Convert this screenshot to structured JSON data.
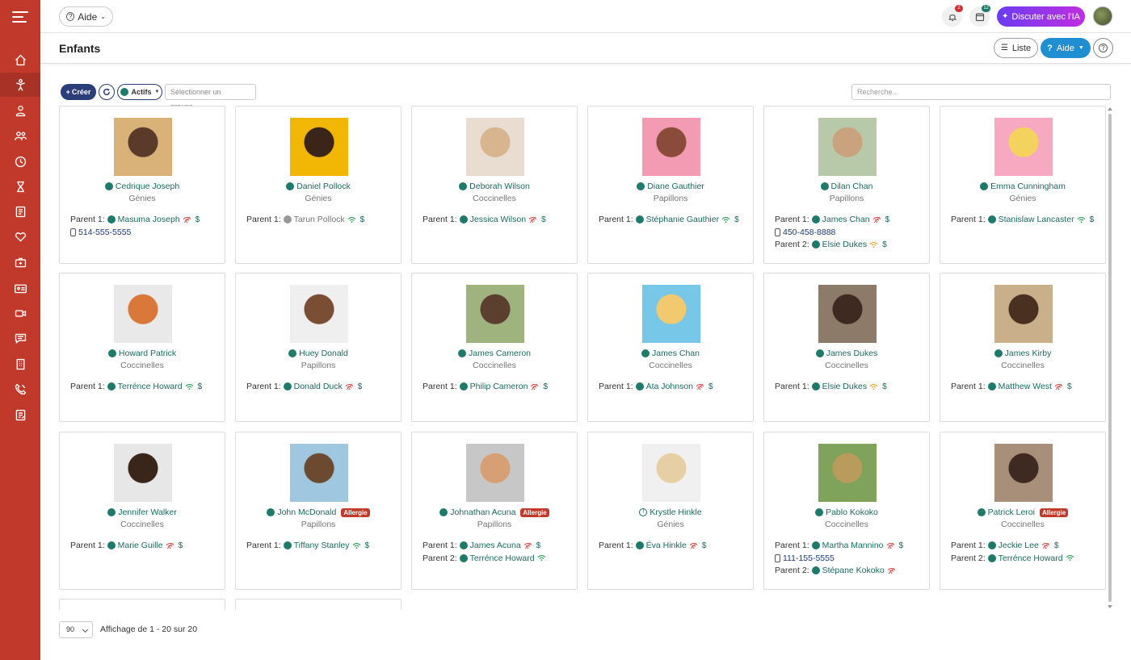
{
  "topbar": {
    "aide_label": "Aide",
    "notifications_count": "2",
    "calendar_count": "12",
    "ai_label": "Discuter avec l'IA"
  },
  "header": {
    "title": "Enfants",
    "liste_label": "Liste",
    "aide_label": "Aide"
  },
  "toolbar": {
    "create_label": "Créer",
    "status_label": "Actifs",
    "group_placeholder": "Sélectionner un groupe...",
    "search_placeholder": "Recherche..."
  },
  "colors": {
    "sidebar": "#c0392b",
    "accent_navy": "#2c3e7a",
    "active_dot": "#1e7a6a",
    "link": "#1a6b60",
    "allergy_badge": "#c0392b",
    "ai_gradient_start": "#6a3df0",
    "ai_gradient_end": "#c02ee0",
    "help_blue": "#1f8fd1"
  },
  "labels": {
    "parent1": "Parent 1:",
    "parent2": "Parent 2:",
    "dollar": "$",
    "allergy": "Allergie"
  },
  "children": [
    {
      "name": "Cedrique Joseph",
      "group": "Génies",
      "parents": [
        {
          "label": "Parent 1:",
          "name": "Masuma Joseph",
          "wifi": "red",
          "dollar": true
        }
      ],
      "phone": "514-555-5555"
    },
    {
      "name": "Daniel Pollock",
      "group": "Génies",
      "parents": [
        {
          "label": "Parent 1:",
          "name": "Tarun Pollock",
          "wifi": "green",
          "dollar": true,
          "inactive": true
        }
      ]
    },
    {
      "name": "Deborah Wilson",
      "group": "Coccinelles",
      "parents": [
        {
          "label": "Parent 1:",
          "name": "Jessica Wilson",
          "wifi": "red",
          "dollar": true
        }
      ]
    },
    {
      "name": "Diane Gauthier",
      "group": "Papillons",
      "parents": [
        {
          "label": "Parent 1:",
          "name": "Stéphanie Gauthier",
          "wifi": "green",
          "dollar": true
        }
      ]
    },
    {
      "name": "Dilan Chan",
      "group": "Papillons",
      "parents": [
        {
          "label": "Parent 1:",
          "name": "James Chan",
          "wifi": "red",
          "dollar": true
        },
        {
          "label": "Parent 2:",
          "name": "Elsie Dukes",
          "wifi": "orange",
          "dollar": true
        }
      ],
      "phone": "450-458-8888"
    },
    {
      "name": "Emma Cunningham",
      "group": "Génies",
      "parents": [
        {
          "label": "Parent 1:",
          "name": "Stanislaw Lancaster",
          "wifi": "green",
          "dollar": true
        }
      ]
    },
    {
      "name": "Howard Patrick",
      "group": "Coccinelles",
      "parents": [
        {
          "label": "Parent 1:",
          "name": "Terrénce Howard",
          "wifi": "green",
          "dollar": true
        }
      ]
    },
    {
      "name": "Huey Donald",
      "group": "Papillons",
      "parents": [
        {
          "label": "Parent 1:",
          "name": "Donald Duck",
          "wifi": "red",
          "dollar": true
        }
      ]
    },
    {
      "name": "James Cameron",
      "group": "Coccinelles",
      "parents": [
        {
          "label": "Parent 1:",
          "name": "Philip Cameron",
          "wifi": "red",
          "dollar": true
        }
      ]
    },
    {
      "name": "James Chan",
      "group": "Coccinelles",
      "parents": [
        {
          "label": "Parent 1:",
          "name": "Ata Johnson",
          "wifi": "red",
          "dollar": true
        }
      ]
    },
    {
      "name": "James Dukes",
      "group": "Coccinelles",
      "parents": [
        {
          "label": "Parent 1:",
          "name": "Elsie Dukes",
          "wifi": "orange",
          "dollar": true
        }
      ]
    },
    {
      "name": "James Kirby",
      "group": "Coccinelles",
      "parents": [
        {
          "label": "Parent 1:",
          "name": "Matthew West",
          "wifi": "red",
          "dollar": true
        }
      ]
    },
    {
      "name": "Jennifer Walker",
      "group": "Coccinelles",
      "parents": [
        {
          "label": "Parent 1:",
          "name": "Marie Guille",
          "wifi": "red",
          "dollar": true
        }
      ]
    },
    {
      "name": "John McDonald",
      "group": "Papillons",
      "allergy": true,
      "parents": [
        {
          "label": "Parent 1:",
          "name": "Tiffany Stanley",
          "wifi": "green",
          "dollar": true
        }
      ]
    },
    {
      "name": "Johnathan Acuna",
      "group": "Papillons",
      "allergy": true,
      "parents": [
        {
          "label": "Parent 1:",
          "name": "James Acuna",
          "wifi": "red",
          "dollar": true
        },
        {
          "label": "Parent 2:",
          "name": "Terrénce Howard",
          "wifi": "green",
          "dollar": false
        }
      ]
    },
    {
      "name": "Krystle Hinkle",
      "group": "Génies",
      "warning": true,
      "parents": [
        {
          "label": "Parent 1:",
          "name": "Éva Hinkle",
          "wifi": "red",
          "dollar": true
        }
      ]
    },
    {
      "name": "Pablo Kokoko",
      "group": "Coccinelles",
      "parents": [
        {
          "label": "Parent 1:",
          "name": "Martha Mannino",
          "wifi": "red",
          "dollar": true
        },
        {
          "label": "Parent 2:",
          "name": "Stépane Kokoko",
          "wifi": "red",
          "dollar": false
        }
      ],
      "phone": "111-155-5555"
    },
    {
      "name": "Patrick Leroi",
      "group": "Coccinelles",
      "allergy": true,
      "parents": [
        {
          "label": "Parent 1:",
          "name": "Jeckie Lee",
          "wifi": "red",
          "dollar": true
        },
        {
          "label": "Parent 2:",
          "name": "Terrénce Howard",
          "wifi": "green",
          "dollar": false
        }
      ]
    }
  ],
  "footer": {
    "per_page": "90",
    "showing": "Affichage de 1 - 20 sur 20"
  }
}
